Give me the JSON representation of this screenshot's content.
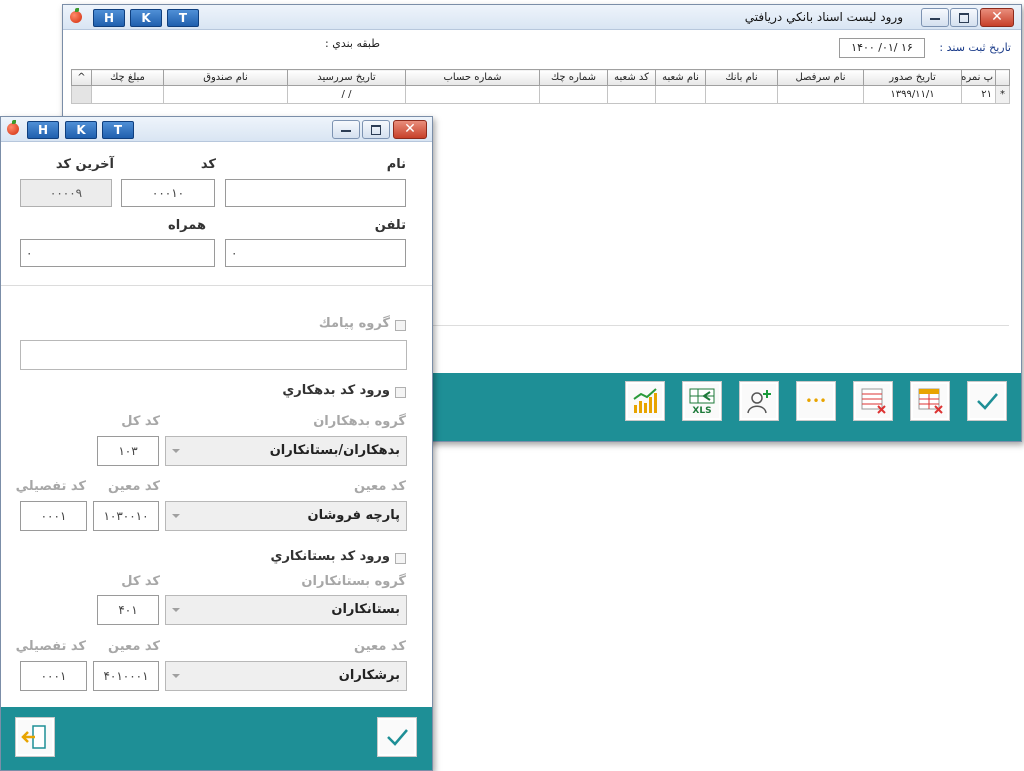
{
  "back_window": {
    "title": "ورود ليست اسناد بانكي دريافتي",
    "hkt": [
      "H",
      "K",
      "T"
    ],
    "reg_date_label": "تاريخ ثبت سند  :",
    "reg_date_value": "۱۴۰۰ /۰۱/ ۱۶",
    "category_label": "طبقه بندي  :",
    "columns": [
      "پ نمره",
      "تاريخ صدور",
      "نام سرفصل",
      "نام بانك",
      "نام شعبه",
      "كد شعبه",
      "شماره چك",
      "شماره حساب",
      "تاريخ سررسيد",
      "نام صندوق",
      "مبلغ چك"
    ],
    "rows": [
      {
        "marker": "*",
        "cells": [
          "۲۱",
          "۱۳۹۹/۱۱/۱",
          "",
          "",
          "",
          "",
          "",
          "",
          "/  /",
          "",
          ""
        ]
      }
    ],
    "scroll_up": "^",
    "toolbar": [
      "chart-icon",
      "xls-icon",
      "add-user-icon",
      "more-icon",
      "delete-rows-icon",
      "delete-table-icon",
      "confirm-icon"
    ],
    "xls_text": "XLS",
    "more_text": "•••"
  },
  "front_window": {
    "hkt": [
      "H",
      "K",
      "T"
    ],
    "labels": {
      "name": "نام",
      "code": "كد",
      "last_code": "آخرين كد",
      "phone": "تلفن",
      "mobile": "همراه",
      "sms_group": "گروه پيامك",
      "debtor_code_entry": "ورود كد بدهكاري",
      "debtor_group": "گروه بدهكاران",
      "total_code": "كد كل",
      "moein": "كد معين",
      "tafsili": "كد تفصيلي",
      "creditor_code_entry": "ورود كد بستانكاري",
      "creditor_group": "گروه بستانكاران",
      "total_code2": "كد كل",
      "moein2": "كد معين",
      "tafsili2": "كد تفصيلي",
      "moein_lbl2": "كد معين",
      "moein_lbl": "كد معين"
    },
    "values": {
      "name": "",
      "code": "۰۰۰۱۰",
      "last_code": "۰۰۰۰۹",
      "phone": "۰",
      "mobile": "۰",
      "sms_group": "",
      "debtor_group": "بدهكاران/بستانكاران",
      "debtor_total": "۱۰۳",
      "debtor_moein_name": "پارچه فروشان",
      "debtor_moein": "۱۰۳۰۰۱۰",
      "debtor_tafsili": "۰۰۰۱",
      "creditor_group": "بستانكاران",
      "creditor_total": "۴۰۱",
      "creditor_moein_name": "برشكاران",
      "creditor_moein": "۴۰۱۰۰۰۱",
      "creditor_tafsili": "۰۰۰۱"
    },
    "footer": [
      "exit-icon",
      "confirm-icon"
    ]
  },
  "colors": {
    "teal": "#1e8f96",
    "title_bg": "#dfe9f5",
    "hkt": "#2f6fbf",
    "close": "#c7402a"
  }
}
